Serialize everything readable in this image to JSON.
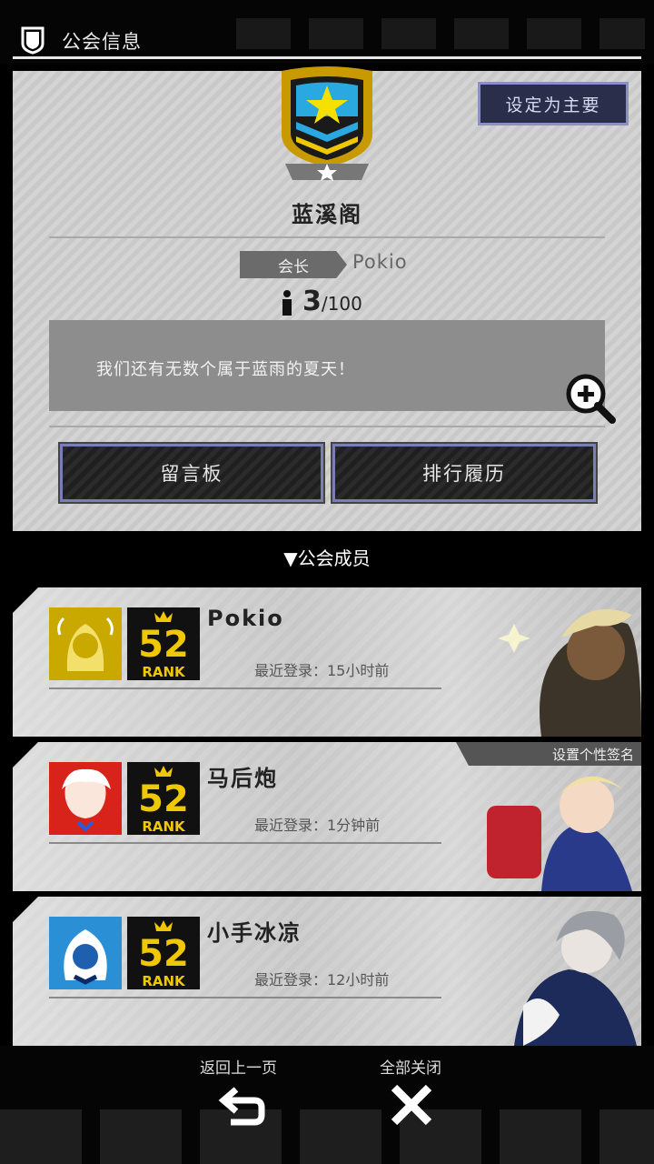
{
  "header": {
    "title": "公会信息"
  },
  "guild": {
    "set_main_label": "设定为主要",
    "name": "蓝溪阁",
    "leader_label": "会长",
    "leader_name": "Pokio",
    "member_count": "3",
    "member_max": "/100",
    "notice": "我们还有无数个属于蓝雨的夏天！",
    "message_board_label": "留言板",
    "ranking_history_label": "排行履历"
  },
  "members_section": {
    "label": "▼公会成员"
  },
  "members": [
    {
      "name": "Pokio",
      "last_login": "最近登录：15小时前",
      "rank": "52",
      "rank_word": "RANK",
      "avatar_color": "#c9a800"
    },
    {
      "name": "马后炮",
      "last_login": "最近登录：1分钟前",
      "rank": "52",
      "rank_word": "RANK",
      "avatar_color": "#d8231b",
      "signature_tag": "设置个性签名"
    },
    {
      "name": "小手冰凉",
      "last_login": "最近登录：12小时前",
      "rank": "52",
      "rank_word": "RANK",
      "avatar_color": "#2b8fd6"
    }
  ],
  "bottom_nav": {
    "back_label": "返回上一页",
    "close_all_label": "全部关闭"
  },
  "icons": {
    "header": "shield-icon",
    "zoom": "zoom-in-icon",
    "back": "return-arrow-icon",
    "close": "close-icon"
  },
  "colors": {
    "accent_gold": "#f0c800",
    "panel_bg": "#d0d0d0",
    "button_border": "#7a7fb3"
  }
}
